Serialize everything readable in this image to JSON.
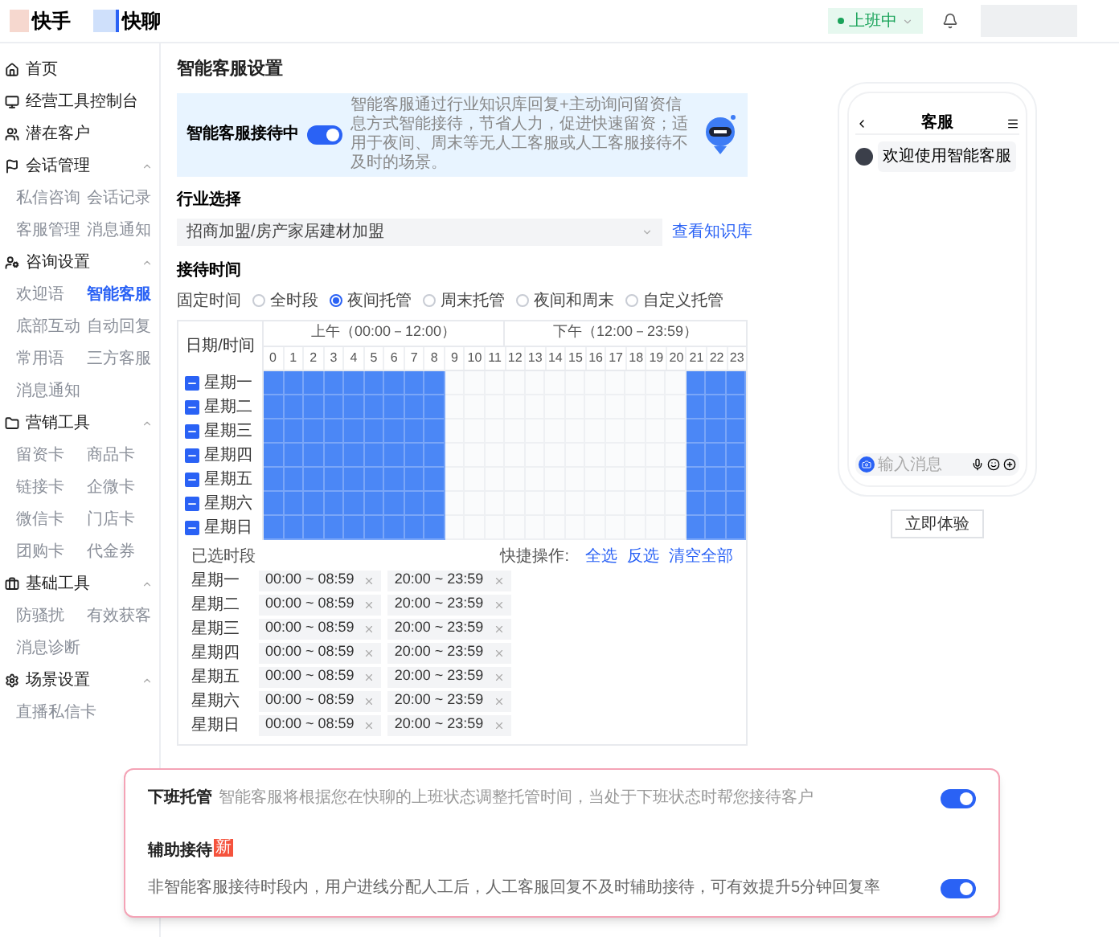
{
  "header": {
    "brand_1": "快手",
    "brand_2": "快聊",
    "status": "上班中"
  },
  "sidebar": {
    "items": [
      {
        "label": "首页"
      },
      {
        "label": "经营工具控制台"
      },
      {
        "label": "潜在客户"
      },
      {
        "label": "会话管理",
        "expanded": true,
        "children": [
          {
            "label": "私信咨询",
            "selected": false
          },
          {
            "label": "会话记录",
            "selected": false
          },
          {
            "label": "客服管理",
            "selected": false
          },
          {
            "label": "消息通知",
            "selected": false
          }
        ]
      },
      {
        "label": "咨询设置",
        "expanded": true,
        "children": [
          {
            "label": "欢迎语",
            "selected": false
          },
          {
            "label": "智能客服",
            "selected": true
          },
          {
            "label": "底部互动",
            "selected": false
          },
          {
            "label": "自动回复",
            "selected": false
          },
          {
            "label": "常用语",
            "selected": false
          },
          {
            "label": "三方客服",
            "selected": false
          },
          {
            "label": "消息通知",
            "selected": false
          }
        ]
      },
      {
        "label": "营销工具",
        "expanded": true,
        "children": [
          {
            "label": "留资卡",
            "selected": false
          },
          {
            "label": "商品卡",
            "selected": false
          },
          {
            "label": "链接卡",
            "selected": false
          },
          {
            "label": "企微卡",
            "selected": false
          },
          {
            "label": "微信卡",
            "selected": false
          },
          {
            "label": "门店卡",
            "selected": false
          },
          {
            "label": "团购卡",
            "selected": false
          },
          {
            "label": "代金券",
            "selected": false
          }
        ]
      },
      {
        "label": "基础工具",
        "expanded": true,
        "children": [
          {
            "label": "防骚扰",
            "selected": false
          },
          {
            "label": "有效获客",
            "selected": false
          },
          {
            "label": "消息诊断",
            "selected": false
          }
        ]
      },
      {
        "label": "场景设置",
        "expanded": true,
        "children": [
          {
            "label": "直播私信卡",
            "selected": false
          }
        ]
      }
    ]
  },
  "page_title": "智能客服设置",
  "banner": {
    "label": "智能客服接待中",
    "on": true,
    "text": "智能客服通过行业知识库回复+主动询问留资信息方式智能接待，节省人力，促进快速留资；适用于夜间、周末等无人工客服或人工客服接待不及时的场景。"
  },
  "industry": {
    "heading": "行业选择",
    "value": "招商加盟/房产家居建材加盟",
    "link": "查看知识库"
  },
  "reception": {
    "heading": "接待时间",
    "mode_label": "固定时间",
    "options": [
      {
        "label": "全时段",
        "selected": false
      },
      {
        "label": "夜间托管",
        "selected": true
      },
      {
        "label": "周末托管",
        "selected": false
      },
      {
        "label": "夜间和周末",
        "selected": false
      },
      {
        "label": "自定义托管",
        "selected": false
      }
    ]
  },
  "schedule": {
    "corner": "日期/时间",
    "am": "上午（00:00－12:00）",
    "pm": "下午（12:00－23:59）",
    "hours": [
      "0",
      "1",
      "2",
      "3",
      "4",
      "5",
      "6",
      "7",
      "8",
      "9",
      "10",
      "11",
      "12",
      "13",
      "14",
      "15",
      "16",
      "17",
      "18",
      "19",
      "20",
      "21",
      "22",
      "23"
    ],
    "rows": [
      {
        "day": "星期一",
        "indeterminate": true,
        "cells": [
          true,
          true,
          true,
          true,
          true,
          true,
          true,
          true,
          true,
          false,
          false,
          false,
          false,
          false,
          false,
          false,
          false,
          false,
          false,
          false,
          false,
          true,
          true,
          true
        ]
      },
      {
        "day": "星期二",
        "indeterminate": true,
        "cells": [
          true,
          true,
          true,
          true,
          true,
          true,
          true,
          true,
          true,
          false,
          false,
          false,
          false,
          false,
          false,
          false,
          false,
          false,
          false,
          false,
          false,
          true,
          true,
          true
        ]
      },
      {
        "day": "星期三",
        "indeterminate": true,
        "cells": [
          true,
          true,
          true,
          true,
          true,
          true,
          true,
          true,
          true,
          false,
          false,
          false,
          false,
          false,
          false,
          false,
          false,
          false,
          false,
          false,
          false,
          true,
          true,
          true
        ]
      },
      {
        "day": "星期四",
        "indeterminate": true,
        "cells": [
          true,
          true,
          true,
          true,
          true,
          true,
          true,
          true,
          true,
          false,
          false,
          false,
          false,
          false,
          false,
          false,
          false,
          false,
          false,
          false,
          false,
          true,
          true,
          true
        ]
      },
      {
        "day": "星期五",
        "indeterminate": true,
        "cells": [
          true,
          true,
          true,
          true,
          true,
          true,
          true,
          true,
          true,
          false,
          false,
          false,
          false,
          false,
          false,
          false,
          false,
          false,
          false,
          false,
          false,
          true,
          true,
          true
        ]
      },
      {
        "day": "星期六",
        "indeterminate": true,
        "cells": [
          true,
          true,
          true,
          true,
          true,
          true,
          true,
          true,
          true,
          false,
          false,
          false,
          false,
          false,
          false,
          false,
          false,
          false,
          false,
          false,
          false,
          true,
          true,
          true
        ]
      },
      {
        "day": "星期日",
        "indeterminate": true,
        "cells": [
          true,
          true,
          true,
          true,
          true,
          true,
          true,
          true,
          true,
          false,
          false,
          false,
          false,
          false,
          false,
          false,
          false,
          false,
          false,
          false,
          false,
          true,
          true,
          true
        ]
      }
    ]
  },
  "selected_periods": {
    "heading": "已选时段",
    "quick_label": "快捷操作:",
    "actions": [
      "全选",
      "反选",
      "清空全部"
    ],
    "rows": [
      {
        "day": "星期一",
        "ranges": [
          "00:00 ~ 08:59",
          "20:00 ~ 23:59"
        ]
      },
      {
        "day": "星期二",
        "ranges": [
          "00:00 ~ 08:59",
          "20:00 ~ 23:59"
        ]
      },
      {
        "day": "星期三",
        "ranges": [
          "00:00 ~ 08:59",
          "20:00 ~ 23:59"
        ]
      },
      {
        "day": "星期四",
        "ranges": [
          "00:00 ~ 08:59",
          "20:00 ~ 23:59"
        ]
      },
      {
        "day": "星期五",
        "ranges": [
          "00:00 ~ 08:59",
          "20:00 ~ 23:59"
        ]
      },
      {
        "day": "星期六",
        "ranges": [
          "00:00 ~ 08:59",
          "20:00 ~ 23:59"
        ]
      },
      {
        "day": "星期日",
        "ranges": [
          "00:00 ~ 08:59",
          "20:00 ~ 23:59"
        ]
      }
    ]
  },
  "preview": {
    "title": "客服",
    "message": "欢迎使用智能客服",
    "input_placeholder": "输入消息",
    "button": "立即体验"
  },
  "options_panel": [
    {
      "kind": "inline",
      "title": "下班托管",
      "description": "智能客服将根据您在快聊的上班状态调整托管时间，当处于下班状态时帮您接待客户",
      "on": true
    },
    {
      "kind": "stacked",
      "title": "辅助接待",
      "badge": "新",
      "description": "非智能客服接待时段内，用户进线分配人工后，人工客服回复不及时辅助接待，可有效提升5分钟回复率",
      "on": true
    }
  ]
}
